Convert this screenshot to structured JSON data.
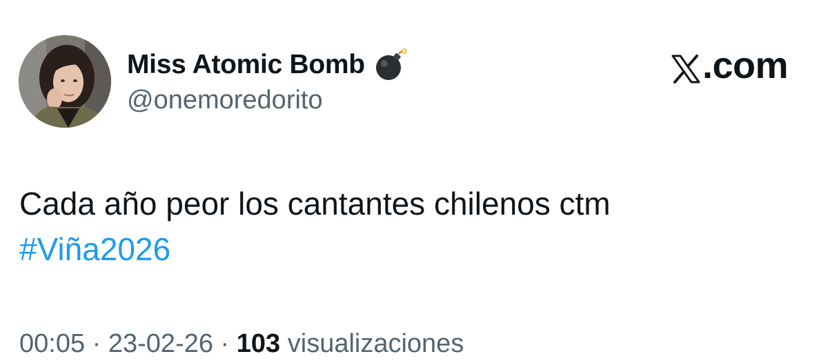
{
  "author": {
    "display_name": "Miss Atomic Bomb",
    "name_icon": "bomb-emoji",
    "handle": "@onemoredorito",
    "avatar": "profile-photo"
  },
  "brand": {
    "logo_text": ".com",
    "logo_icon": "x-logo"
  },
  "tweet": {
    "text": "Cada año peor los cantantes chilenos ctm",
    "hashtag": "#Viña2026"
  },
  "meta": {
    "time": "00:05",
    "separator1": " · ",
    "date": "23-02-26",
    "separator2": " · ",
    "views_count": "103",
    "views_label": " visualizaciones"
  },
  "colors": {
    "text": "#0f1419",
    "secondary": "#536471",
    "link": "#1d9bf0",
    "background": "#ffffff"
  }
}
